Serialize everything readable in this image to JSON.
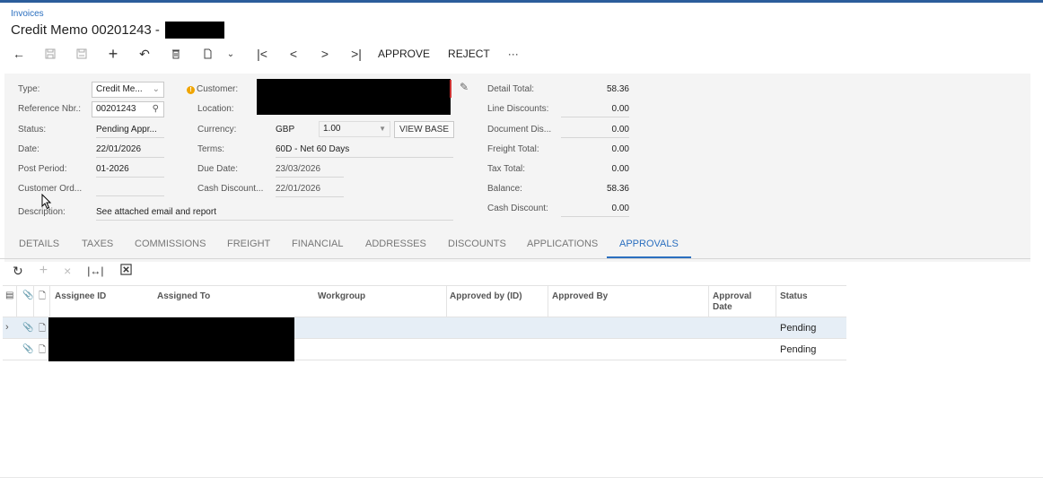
{
  "breadcrumb": "Invoices",
  "title": "Credit Memo 00201243 -",
  "toolbar": {
    "approve": "APPROVE",
    "reject": "REJECT",
    "more": "···"
  },
  "summary": {
    "type_label": "Type:",
    "type_value": "Credit Me...",
    "ref_label": "Reference Nbr.:",
    "ref_value": "00201243",
    "status_label": "Status:",
    "status_value": "Pending Appr...",
    "date_label": "Date:",
    "date_value": "22/01/2026",
    "post_period_label": "Post Period:",
    "post_period_value": "01-2026",
    "customer_order_label": "Customer Ord...",
    "description_label": "Description:",
    "description_value": "See attached email and report",
    "customer_label": "Customer:",
    "location_label": "Location:",
    "currency_label": "Currency:",
    "currency_code": "GBP",
    "currency_rate": "1.00",
    "view_base": "VIEW BASE",
    "terms_label": "Terms:",
    "terms_value": "60D - Net 60 Days",
    "due_date_label": "Due Date:",
    "due_date_value": "23/03/2026",
    "cash_discount_date_label": "Cash Discount...",
    "cash_discount_date_value": "22/01/2026",
    "detail_total_label": "Detail Total:",
    "detail_total_value": "58.36",
    "line_discounts_label": "Line Discounts:",
    "line_discounts_value": "0.00",
    "document_dis_label": "Document Dis...",
    "document_dis_value": "0.00",
    "freight_total_label": "Freight Total:",
    "freight_total_value": "0.00",
    "tax_total_label": "Tax Total:",
    "tax_total_value": "0.00",
    "balance_label": "Balance:",
    "balance_value": "58.36",
    "cash_discount_label": "Cash Discount:",
    "cash_discount_value": "0.00"
  },
  "tabs": [
    "DETAILS",
    "TAXES",
    "COMMISSIONS",
    "FREIGHT",
    "FINANCIAL",
    "ADDRESSES",
    "DISCOUNTS",
    "APPLICATIONS",
    "APPROVALS"
  ],
  "active_tab": "APPROVALS",
  "grid": {
    "columns": [
      "Assignee ID",
      "Assigned To",
      "Workgroup",
      "Approved by (ID)",
      "Approved By",
      "Approval Date",
      "Status"
    ],
    "rows": [
      {
        "status": "Pending"
      },
      {
        "status": "Pending"
      }
    ]
  },
  "colors": {
    "accent": "#2b6fbf",
    "panel": "#f4f4f4",
    "selected_row": "#e6eef6",
    "warning": "#f0a500"
  }
}
